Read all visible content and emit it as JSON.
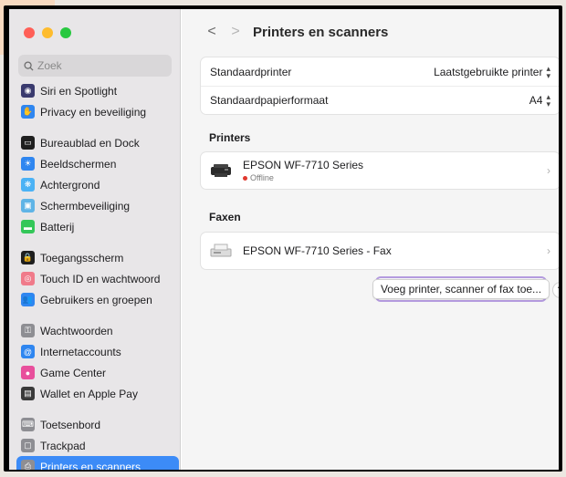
{
  "search": {
    "placeholder": "Zoek"
  },
  "sidebar": {
    "items": [
      {
        "label": "Siri en Spotlight",
        "icon": "siri-icon",
        "color": "#3a3a6e"
      },
      {
        "label": "Privacy en beveiliging",
        "icon": "hand-icon",
        "color": "#2f86f0"
      },
      {
        "label": "Bureaublad en Dock",
        "icon": "dock-icon",
        "color": "#1f1f1f"
      },
      {
        "label": "Beeldschermen",
        "icon": "display-icon",
        "color": "#2f86f0"
      },
      {
        "label": "Achtergrond",
        "icon": "wallpaper-icon",
        "color": "#4bb2f5"
      },
      {
        "label": "Schermbeveiliging",
        "icon": "screensaver-icon",
        "color": "#5fb4e6"
      },
      {
        "label": "Batterij",
        "icon": "battery-icon",
        "color": "#34c759"
      },
      {
        "label": "Toegangsscherm",
        "icon": "lock-icon",
        "color": "#1f1f1f"
      },
      {
        "label": "Touch ID en wachtwoord",
        "icon": "fingerprint-icon",
        "color": "#f07a8a"
      },
      {
        "label": "Gebruikers en groepen",
        "icon": "users-icon",
        "color": "#2f86f0"
      },
      {
        "label": "Wachtwoorden",
        "icon": "key-icon",
        "color": "#8e8e93"
      },
      {
        "label": "Internetaccounts",
        "icon": "at-icon",
        "color": "#2f86f0"
      },
      {
        "label": "Game Center",
        "icon": "gamecenter-icon",
        "color": "#e84f9c"
      },
      {
        "label": "Wallet en Apple Pay",
        "icon": "wallet-icon",
        "color": "#3a3a3a"
      },
      {
        "label": "Toetsenbord",
        "icon": "keyboard-icon",
        "color": "#8e8e93"
      },
      {
        "label": "Trackpad",
        "icon": "trackpad-icon",
        "color": "#8e8e93"
      },
      {
        "label": "Printers en scanners",
        "icon": "printer-icon",
        "color": "#8e8e93",
        "active": true
      }
    ]
  },
  "header": {
    "title": "Printers en scanners"
  },
  "defaults": {
    "printer_label": "Standaardprinter",
    "printer_value": "Laatstgebruikte printer",
    "paper_label": "Standaardpapierformaat",
    "paper_value": "A4"
  },
  "printers": {
    "section_title": "Printers",
    "name": "EPSON WF-7710 Series",
    "status": "Offline"
  },
  "faxes": {
    "section_title": "Faxen",
    "name": "EPSON WF-7710 Series - Fax"
  },
  "actions": {
    "add_label": "Voeg printer, scanner of fax toe...",
    "help_label": "?"
  },
  "colors": {
    "accent": "#3c8bf7",
    "highlight_border": "#b49bdf",
    "status_offline": "#e0392f"
  }
}
